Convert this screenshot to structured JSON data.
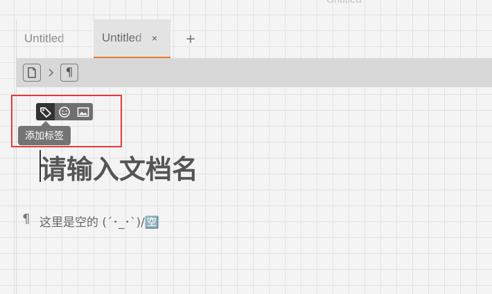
{
  "window": {
    "title": "Untitled"
  },
  "tabs": [
    {
      "label": "Untitled",
      "active": false
    },
    {
      "label": "Untitled",
      "active": true,
      "close_glyph": "×"
    }
  ],
  "tab_add_glyph": "+",
  "breadcrumb": {
    "items": [
      {
        "icon": "document-icon"
      },
      {
        "icon": "pilcrow-icon",
        "glyph": "¶"
      }
    ],
    "separator_icon": "chevron-right-icon"
  },
  "toolbar": {
    "buttons": [
      {
        "icon": "tag-icon",
        "active": true
      },
      {
        "icon": "emoji-icon",
        "active": false
      },
      {
        "icon": "image-icon",
        "active": false
      }
    ],
    "tooltip": "添加标签"
  },
  "document": {
    "title_placeholder": "请输入文档名",
    "paragraph_mark": "¶",
    "empty_text": "这里是空的 (´･_･`)/🈳"
  },
  "colors": {
    "accent": "#e8772d",
    "annotation": "#e53935",
    "toolbar_bg": "#6f6f6f",
    "toolbar_active": "#333333"
  }
}
